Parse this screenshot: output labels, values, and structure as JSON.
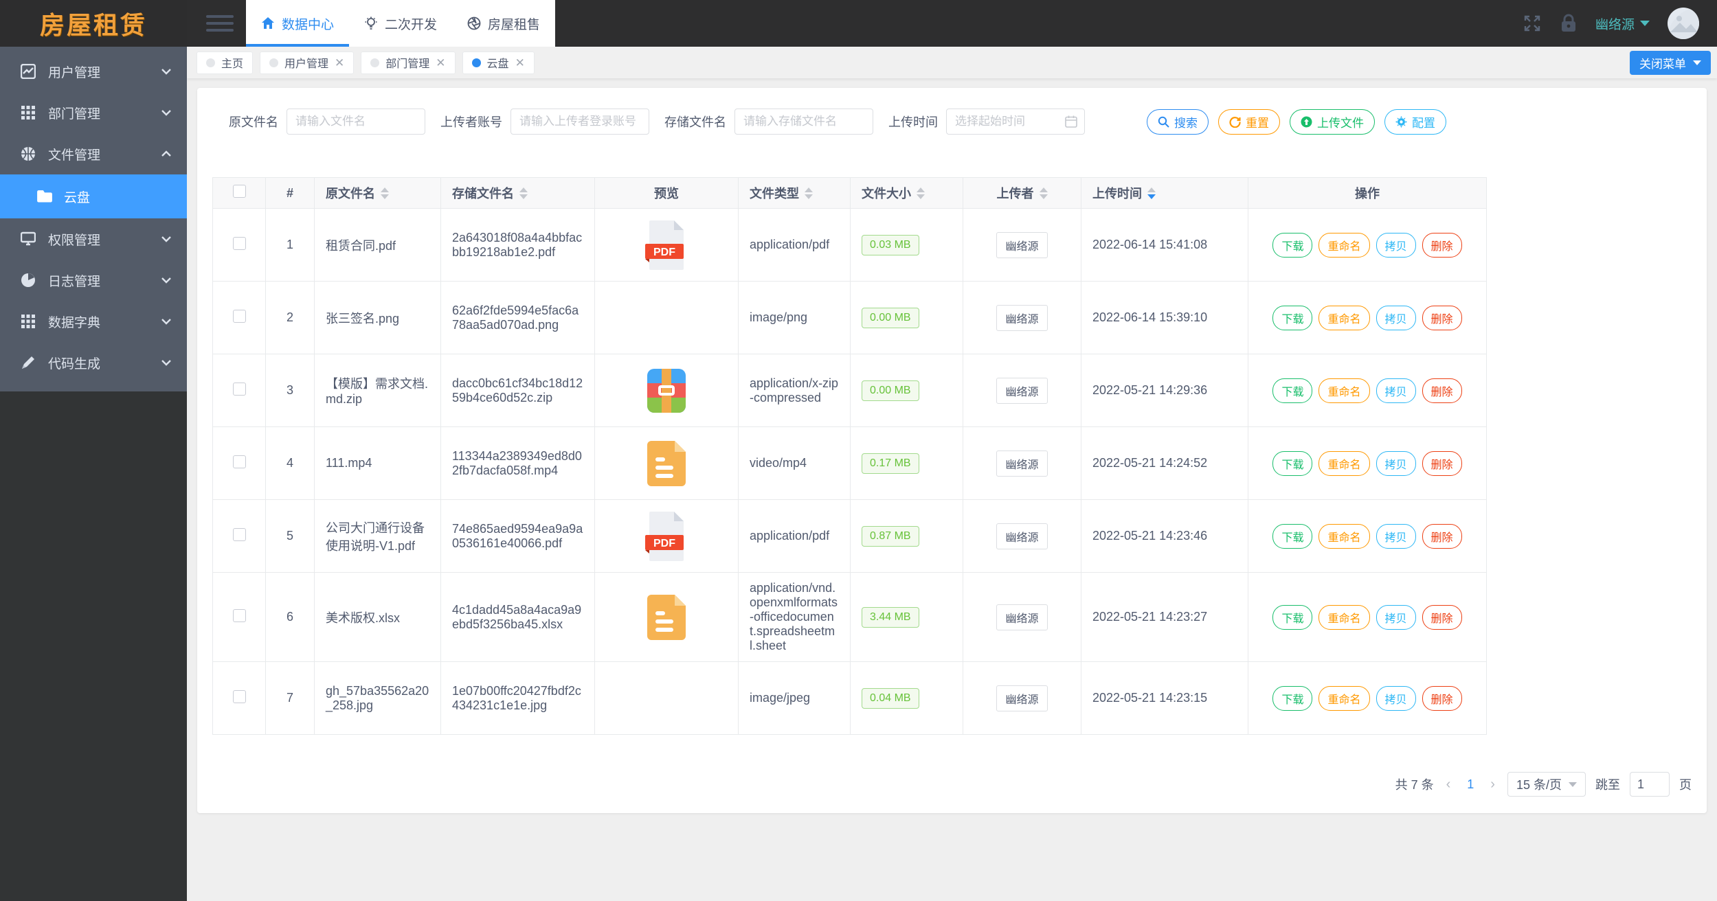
{
  "app": {
    "logo": "房屋租赁"
  },
  "colors": {
    "primary": "#2d8cf0",
    "success": "#19be6b",
    "warning": "#ff9900",
    "info": "#2db7f5",
    "error": "#ed4014",
    "sidebar_active": "#409eff",
    "username": "#4dbcbe",
    "logo": "#f2a13c",
    "size_badge_text": "#67c23a"
  },
  "sidebar": {
    "items": [
      {
        "label": "用户管理",
        "icon": "line-chart-icon",
        "chevron": "down"
      },
      {
        "label": "部门管理",
        "icon": "grid-icon",
        "chevron": "down"
      },
      {
        "label": "文件管理",
        "icon": "basketball-icon",
        "chevron": "up"
      },
      {
        "label": "云盘",
        "icon": "folder-icon",
        "sub": true,
        "active": true
      },
      {
        "label": "权限管理",
        "icon": "monitor-icon",
        "chevron": "down"
      },
      {
        "label": "日志管理",
        "icon": "pie-chart-icon",
        "chevron": "down"
      },
      {
        "label": "数据字典",
        "icon": "grid-icon",
        "chevron": "down"
      },
      {
        "label": "代码生成",
        "icon": "brush-icon",
        "chevron": "down"
      }
    ]
  },
  "topnav": {
    "tabs": [
      {
        "label": "数据中心",
        "icon": "home-icon",
        "active": true
      },
      {
        "label": "二次开发",
        "icon": "bulb-icon",
        "active": false
      },
      {
        "label": "房屋租售",
        "icon": "aperture-icon",
        "active": false
      }
    ],
    "username": "幽络源"
  },
  "tabbar": {
    "tabs": [
      {
        "label": "主页",
        "closable": false,
        "active": false
      },
      {
        "label": "用户管理",
        "closable": true,
        "active": false
      },
      {
        "label": "部门管理",
        "closable": true,
        "active": false
      },
      {
        "label": "云盘",
        "closable": true,
        "active": true
      }
    ],
    "close_menu_label": "关闭菜单"
  },
  "filters": {
    "fields": [
      {
        "label": "原文件名",
        "placeholder": "请输入文件名",
        "type": "text"
      },
      {
        "label": "上传者账号",
        "placeholder": "请输入上传者登录账号",
        "type": "text"
      },
      {
        "label": "存储文件名",
        "placeholder": "请输入存储文件名",
        "type": "text"
      },
      {
        "label": "上传时间",
        "placeholder": "选择起始时间",
        "type": "date"
      }
    ],
    "buttons": [
      {
        "label": "搜索",
        "icon": "search-icon",
        "color": "#2d8cf0"
      },
      {
        "label": "重置",
        "icon": "refresh-icon",
        "color": "#ff9900"
      },
      {
        "label": "上传文件",
        "icon": "upload-icon",
        "color": "#19be6b"
      },
      {
        "label": "配置",
        "icon": "gear-icon",
        "color": "#2db7f5"
      }
    ]
  },
  "table": {
    "columns": [
      {
        "label": "#",
        "sortable": false,
        "align": "c"
      },
      {
        "label": "原文件名",
        "sortable": true,
        "align": "l"
      },
      {
        "label": "存储文件名",
        "sortable": true,
        "align": "l"
      },
      {
        "label": "预览",
        "sortable": false,
        "align": "c"
      },
      {
        "label": "文件类型",
        "sortable": true,
        "align": "l"
      },
      {
        "label": "文件大小",
        "sortable": true,
        "align": "l"
      },
      {
        "label": "上传者",
        "sortable": true,
        "align": "c"
      },
      {
        "label": "上传时间",
        "sortable": true,
        "sort": "desc",
        "align": "l"
      },
      {
        "label": "操作",
        "sortable": false,
        "align": "c"
      }
    ],
    "actions": [
      "下载",
      "重命名",
      "拷贝",
      "删除"
    ],
    "rows": [
      {
        "index": "1",
        "name": "租赁合同.pdf",
        "stored": "2a643018f08a4a4bbfacbb19218ab1e2.pdf",
        "preview": "pdf-file-icon",
        "type": "application/pdf",
        "size": "0.03 MB",
        "uploader": "幽络源",
        "time": "2022-06-14 15:41:08"
      },
      {
        "index": "2",
        "name": "张三签名.png",
        "stored": "62a6f2fde5994e5fac6a78aa5ad070ad.png",
        "preview": "",
        "type": "image/png",
        "size": "0.00 MB",
        "uploader": "幽络源",
        "time": "2022-06-14 15:39:10"
      },
      {
        "index": "3",
        "name": "【模版】需求文档.md.zip",
        "stored": "dacc0bc61cf34bc18d1259b4ce60d52c.zip",
        "preview": "zip-file-icon",
        "type": "application/x-zip-compressed",
        "size": "0.00 MB",
        "uploader": "幽络源",
        "time": "2022-05-21 14:29:36"
      },
      {
        "index": "4",
        "name": "111.mp4",
        "stored": "113344a2389349ed8d02fb7dacfa058f.mp4",
        "preview": "doc-file-icon",
        "type": "video/mp4",
        "size": "0.17 MB",
        "uploader": "幽络源",
        "time": "2022-05-21 14:24:52"
      },
      {
        "index": "5",
        "name": "公司大门通行设备使用说明-V1.pdf",
        "stored": "74e865aed9594ea9a9a0536161e40066.pdf",
        "preview": "pdf-file-icon",
        "type": "application/pdf",
        "size": "0.87 MB",
        "uploader": "幽络源",
        "time": "2022-05-21 14:23:46"
      },
      {
        "index": "6",
        "name": "美术版权.xlsx",
        "stored": "4c1dadd45a8a4aca9a9ebd5f3256ba45.xlsx",
        "preview": "doc-file-icon",
        "type": "application/vnd.openxmlformats-officedocument.spreadsheetml.sheet",
        "size": "3.44 MB",
        "uploader": "幽络源",
        "time": "2022-05-21 14:23:27"
      },
      {
        "index": "7",
        "name": "gh_57ba35562a20_258.jpg",
        "stored": "1e07b00ffc20427fbdf2c434231c1e1e.jpg",
        "preview": "",
        "type": "image/jpeg",
        "size": "0.04 MB",
        "uploader": "幽络源",
        "time": "2022-05-21 14:23:15"
      }
    ]
  },
  "pagination": {
    "total": "共 7 条",
    "current_page": "1",
    "page_size": "15 条/页",
    "jump_label": "跳至",
    "jump_value": "1",
    "page_unit": "页"
  }
}
